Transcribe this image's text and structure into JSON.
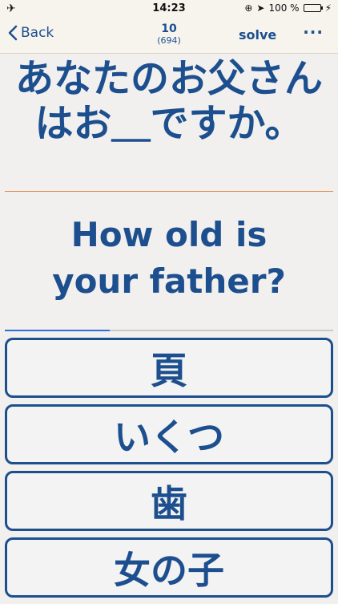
{
  "status_bar": {
    "airplane_icon": "airplane-icon",
    "time": "14:23",
    "battery": "100 %"
  },
  "nav": {
    "back_label": "Back",
    "count": "10",
    "total": "(694)",
    "solve_label": "solve",
    "more_label": "···"
  },
  "question": {
    "text": "あなたのお父さんはお＿ですか。"
  },
  "translation": {
    "line1": "How old is",
    "line2": "your father?"
  },
  "progress": {
    "value": 0.32,
    "color": "#2d6fd6"
  },
  "answers": [
    {
      "label": "頁"
    },
    {
      "label": "いくつ"
    },
    {
      "label": "歯"
    },
    {
      "label": "女の子"
    }
  ],
  "colors": {
    "primary": "#1d4f8f",
    "divider": "#e0843f",
    "background": "#f1f0ee"
  }
}
